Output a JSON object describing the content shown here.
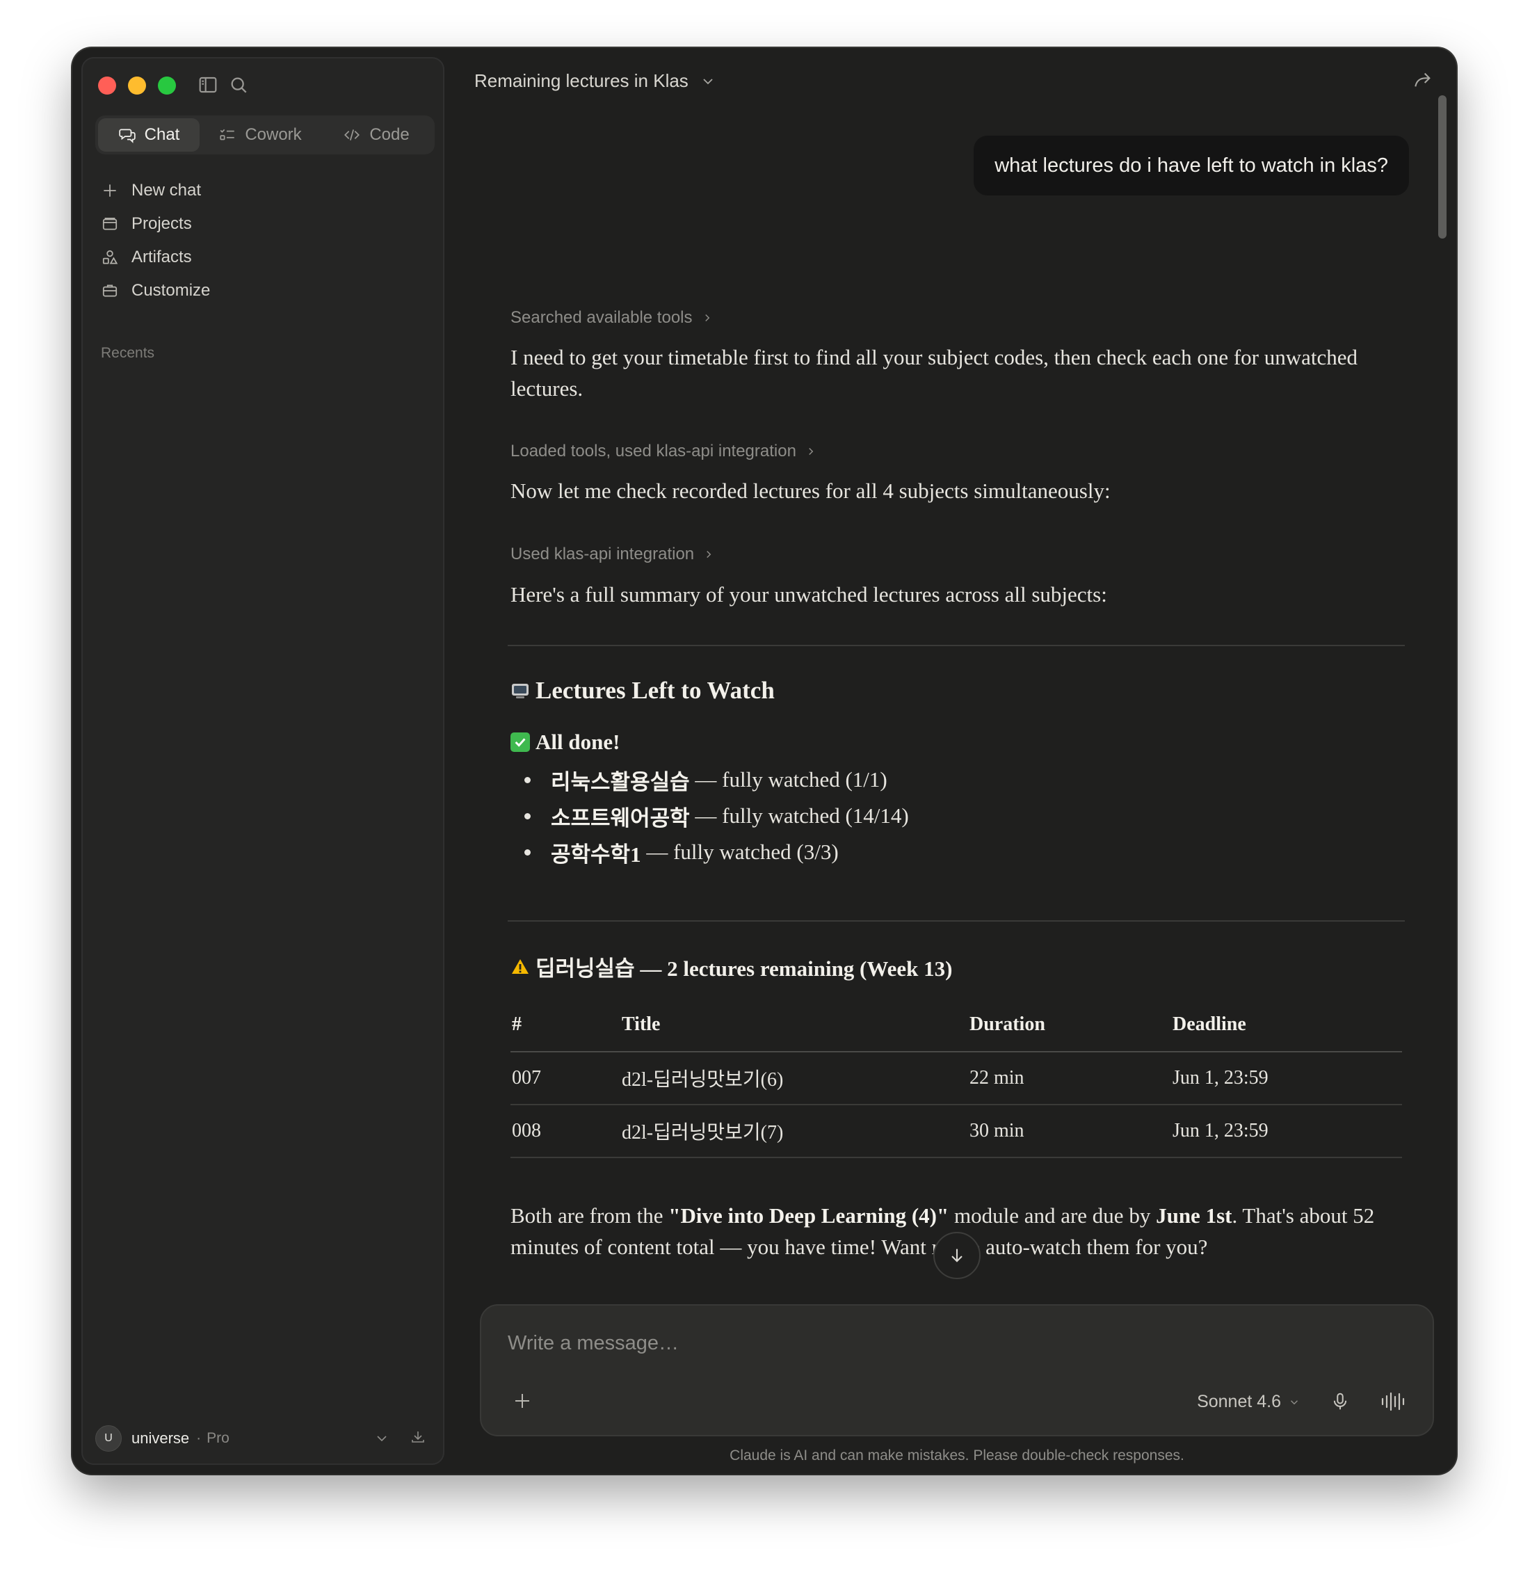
{
  "sidebar": {
    "tabs": [
      {
        "label": "Chat",
        "icon": "chat-bubbles-icon",
        "active": true
      },
      {
        "label": "Cowork",
        "icon": "checklist-icon",
        "active": false
      },
      {
        "label": "Code",
        "icon": "code-brackets-icon",
        "active": false
      }
    ],
    "nav": [
      {
        "label": "New chat",
        "icon": "plus-icon"
      },
      {
        "label": "Projects",
        "icon": "folder-icon"
      },
      {
        "label": "Artifacts",
        "icon": "shapes-icon"
      },
      {
        "label": "Customize",
        "icon": "briefcase-icon"
      }
    ],
    "recents_label": "Recents",
    "user": {
      "initial": "U",
      "name": "universe",
      "separator": "·",
      "plan": "Pro"
    }
  },
  "header": {
    "title": "Remaining lectures in Klas"
  },
  "conversation": {
    "user_message": "what lectures do i have left to watch in klas?",
    "steps": [
      {
        "tool_label": "Searched available tools",
        "text": "I need to get your timetable first to find all your subject codes, then check each one for unwatched lectures."
      },
      {
        "tool_label": "Loaded tools, used klas-api integration",
        "text": "Now let me check recorded lectures for all 4 subjects simultaneously:"
      },
      {
        "tool_label": "Used klas-api integration",
        "text": "Here's a full summary of your unwatched lectures across all subjects:"
      }
    ],
    "summary": {
      "heading": "Lectures Left to Watch",
      "heading_icon": "tv-emoji",
      "done_heading": "All done!",
      "done_icon": "check-mark-emoji",
      "done_items": [
        {
          "name": "리눅스활용실습",
          "status": "— fully watched (1/1)"
        },
        {
          "name": "소프트웨어공학",
          "status": "— fully watched (14/14)"
        },
        {
          "name": "공학수학1",
          "status": "— fully watched (3/3)"
        }
      ],
      "remaining_heading": "딥러닝실습 — 2 lectures remaining (Week 13)",
      "remaining_icon": "warning-emoji",
      "table": {
        "headers": [
          "#",
          "Title",
          "Duration",
          "Deadline"
        ],
        "rows": [
          [
            "007",
            "d2l-딥러닝맛보기(6)",
            "22 min",
            "Jun 1, 23:59"
          ],
          [
            "008",
            "d2l-딥러닝맛보기(7)",
            "30 min",
            "Jun 1, 23:59"
          ]
        ]
      },
      "closing": {
        "p1": "Both are from the ",
        "b1": "\"Dive into Deep Learning (4)\"",
        "p2": " module and are due by ",
        "b2": "June 1st",
        "p3": ". That's about 52 minutes of content total — you have time! Want me to auto-watch them for you?"
      }
    }
  },
  "composer": {
    "placeholder": "Write a message…",
    "model": "Sonnet 4.6"
  },
  "disclaimer": "Claude is AI and can make mistakes. Please double-check responses.",
  "colors": {
    "window_bg": "#1f1f1e",
    "sidebar_bg": "#252524",
    "accent_red": "#ff5f57",
    "accent_yellow": "#febc2e",
    "accent_green": "#28c840"
  }
}
